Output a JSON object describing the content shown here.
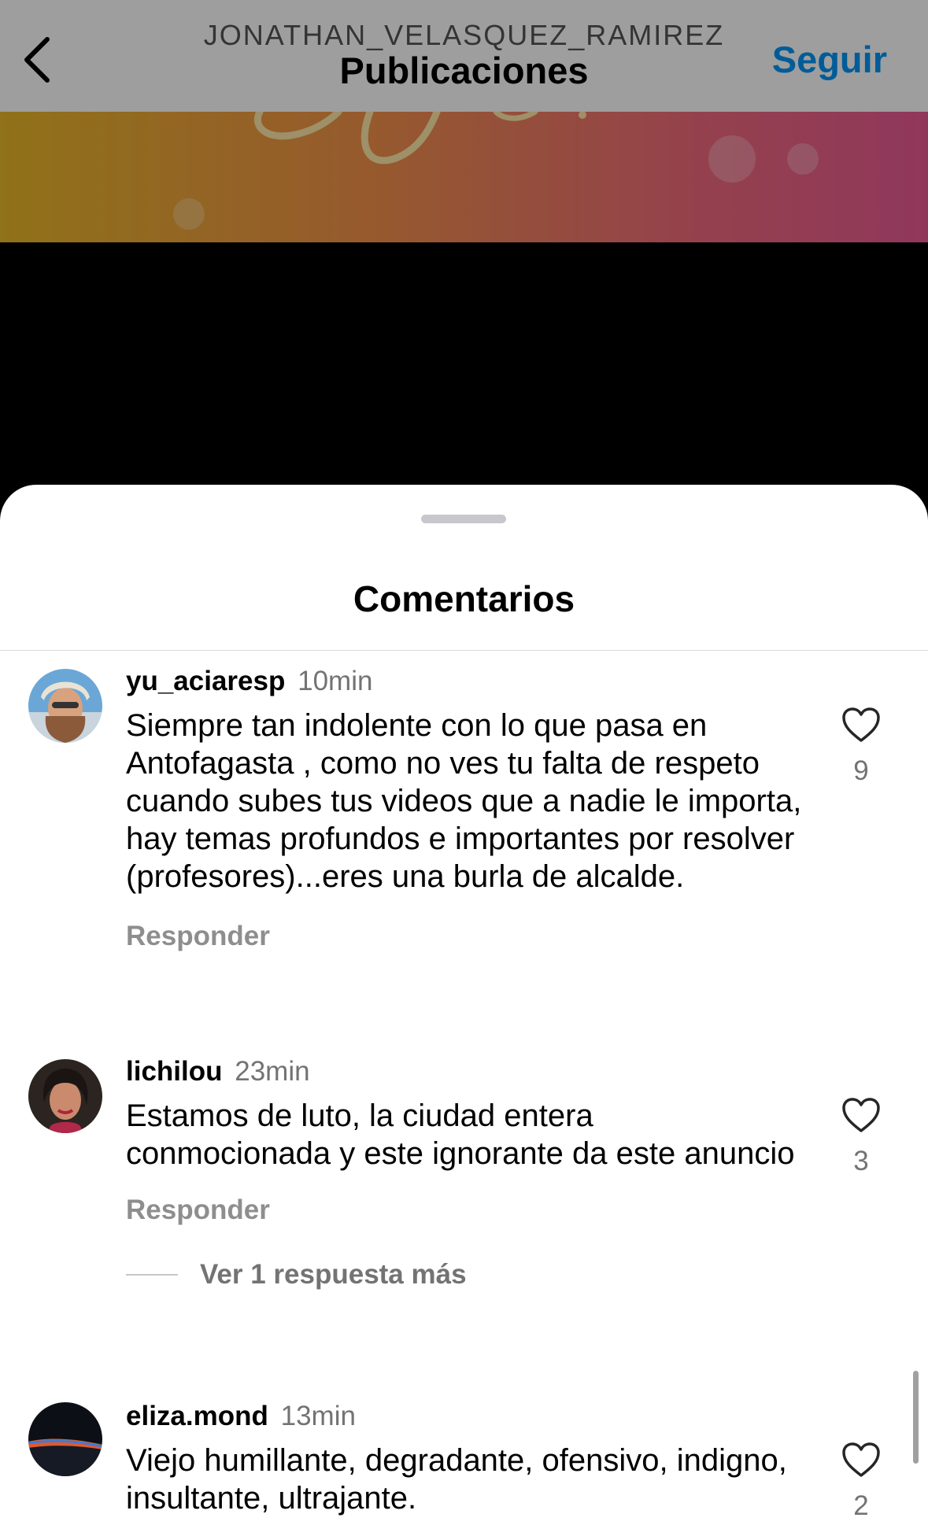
{
  "header": {
    "username": "JONATHAN_VELASQUEZ_RAMIREZ",
    "title": "Publicaciones",
    "follow_label": "Seguir",
    "back_icon": "chevron-left-icon"
  },
  "sheet": {
    "title": "Comentarios"
  },
  "comments": [
    {
      "username": "yu_aciaresp",
      "time": "10min",
      "text": "Siempre tan indolente con lo que pasa en Antofagasta , como no ves tu falta de respeto cuando subes tus videos que a nadie le importa, hay temas profundos e importantes por resolver (profesores)...eres una burla de alcalde.",
      "reply_label": "Responder",
      "likes": "9"
    },
    {
      "username": "lichilou",
      "time": "23min",
      "text": "Estamos de luto, la ciudad entera conmocionada y este ignorante da este anuncio",
      "reply_label": "Responder",
      "likes": "3",
      "more_replies_label": "Ver 1 respuesta más"
    },
    {
      "username": "eliza.mond",
      "time": "13min",
      "text": "Viejo humillante, degradante, ofensivo, indigno, insultante, ultrajante.",
      "likes": "2"
    }
  ],
  "colors": {
    "accent": "#0095f6",
    "secondary_text": "#737373"
  }
}
